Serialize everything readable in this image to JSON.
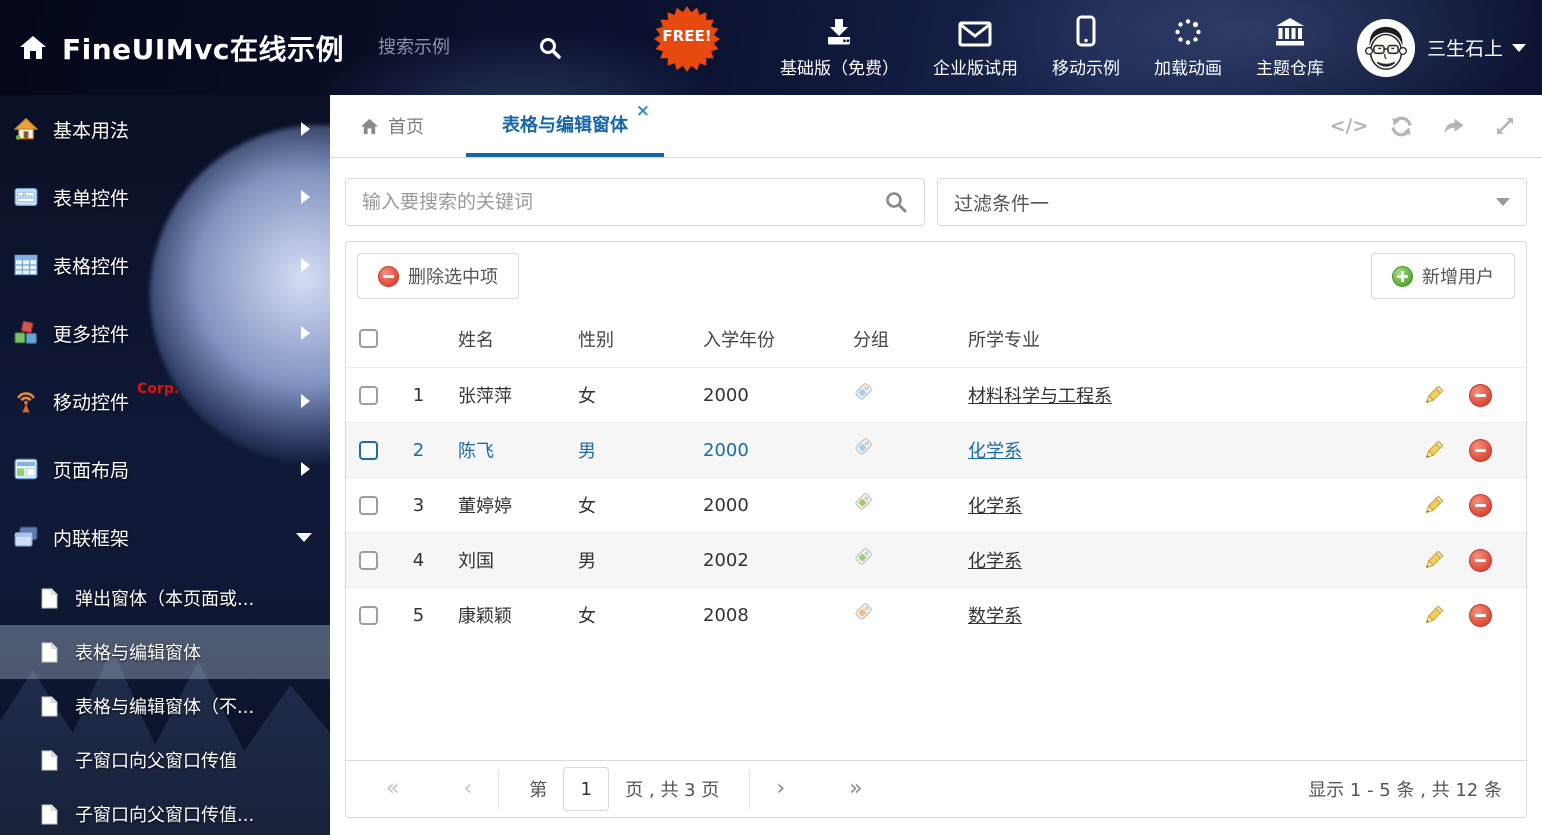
{
  "colors": {
    "accent_blue": "#1567a9",
    "selected_row_blue": "#1b6ca8",
    "free_badge_bg": "#e8490f",
    "corp_badge_red": "#e01010",
    "danger_red": "#dc4634",
    "success_green": "#57a737",
    "tag_blue": "#9bd1f5",
    "tag_green": "#97cf70",
    "tag_orange": "#f9b877",
    "header_bg": "#0b1230"
  },
  "header": {
    "title": "FineUIMvc在线示例",
    "search_placeholder": "搜索示例",
    "free_badge": "FREE!",
    "nav": [
      {
        "label": "基础版（免费）",
        "icon": "download-icon"
      },
      {
        "label": "企业版试用",
        "icon": "envelope-icon"
      },
      {
        "label": "移动示例",
        "icon": "mobile-icon"
      },
      {
        "label": "加载动画",
        "icon": "spinner-icon"
      },
      {
        "label": "主题仓库",
        "icon": "bank-icon"
      }
    ],
    "user_name": "三生石上"
  },
  "sidebar": {
    "items": [
      {
        "label": "基本用法",
        "icon": "home-icon"
      },
      {
        "label": "表单控件",
        "icon": "form-icon"
      },
      {
        "label": "表格控件",
        "icon": "table-icon"
      },
      {
        "label": "更多控件",
        "icon": "cubes-icon"
      },
      {
        "label": "移动控件",
        "badge": "Corp.",
        "icon": "antenna-icon"
      },
      {
        "label": "页面布局",
        "icon": "layout-icon"
      },
      {
        "label": "内联框架",
        "icon": "frames-icon"
      }
    ],
    "subitems": [
      {
        "label": "弹出窗体（本页面或..."
      },
      {
        "label": "表格与编辑窗体"
      },
      {
        "label": "表格与编辑窗体（不..."
      },
      {
        "label": "子窗口向父窗口传值"
      },
      {
        "label": "子窗口向父窗口传值..."
      }
    ]
  },
  "tabs": {
    "home": "首页",
    "active": "表格与编辑窗体",
    "close_icon": "×"
  },
  "filters": {
    "search_placeholder": "输入要搜索的关键词",
    "filter_value": "过滤条件一"
  },
  "toolbar": {
    "delete_label": "删除选中项",
    "add_label": "新增用户"
  },
  "table": {
    "columns": {
      "name": "姓名",
      "gender": "性别",
      "year": "入学年份",
      "group": "分组",
      "major": "所学专业"
    },
    "rows": [
      {
        "num": "1",
        "name": "张萍萍",
        "gender": "女",
        "year": "2000",
        "tag": "blue",
        "major": "材料科学与工程系"
      },
      {
        "num": "2",
        "name": "陈飞",
        "gender": "男",
        "year": "2000",
        "tag": "blue",
        "major": "化学系",
        "selected": true
      },
      {
        "num": "3",
        "name": "董婷婷",
        "gender": "女",
        "year": "2000",
        "tag": "green",
        "major": "化学系"
      },
      {
        "num": "4",
        "name": "刘国",
        "gender": "男",
        "year": "2002",
        "tag": "green",
        "major": "化学系"
      },
      {
        "num": "5",
        "name": "康颖颖",
        "gender": "女",
        "year": "2008",
        "tag": "orange",
        "major": "数学系"
      }
    ]
  },
  "pagination": {
    "first": "«",
    "prev": "‹",
    "page_prefix": "第",
    "page": "1",
    "page_suffix": "页 , 共 3 页",
    "next": "›",
    "last": "»",
    "summary": "显示 1 - 5 条 , 共 12 条"
  }
}
